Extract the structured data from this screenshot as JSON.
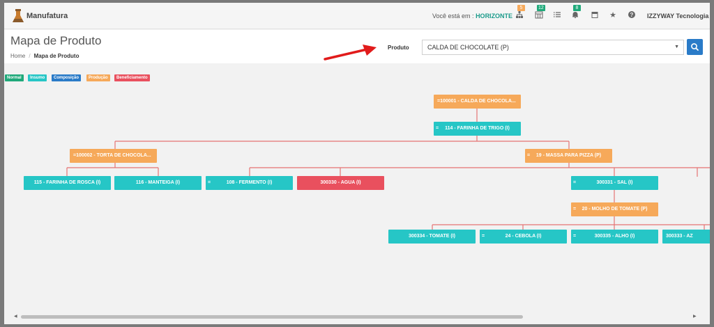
{
  "app": {
    "brand": "Manufatura",
    "location_prefix": "Você está em :",
    "location_value": "HORIZONTE",
    "user": "IZZYWAY Tecnologia"
  },
  "nav_badges": {
    "tree": "5",
    "calendar": "12",
    "bell": "8"
  },
  "colors": {
    "insumo": "#26c6c6",
    "producao": "#f6a95a",
    "beneficiamento": "#e9505e",
    "normal": "#1fa97a",
    "composicao": "#2a7bc8",
    "line": "#e57373"
  },
  "page": {
    "title": "Mapa de Produto",
    "breadcrumb_home": "Home",
    "breadcrumb_sep": "/",
    "breadcrumb_current": "Mapa de Produto"
  },
  "product": {
    "label": "Produto",
    "value": "CALDA DE CHOCOLATE (P)"
  },
  "legend": {
    "normal": "Normal",
    "insumo": "Insumo",
    "composicao": "Composição",
    "producao": "Produção",
    "beneficiamento": "Beneficiamento"
  },
  "nodes": {
    "root": {
      "pre": "=",
      "label": "100001 - CALDA DE CHOCOLA..."
    },
    "n114": {
      "pre": "=",
      "label": "114 - FARINHA DE TRIGO (I)"
    },
    "n100002": {
      "pre": "=",
      "label": "100002 - TORTA DE CHOCOLA..."
    },
    "n19": {
      "pre": "=",
      "label": "19 - MASSA PARA PIZZA (P)"
    },
    "n115": {
      "pre": "",
      "label": "115 - FARINHA DE ROSCA (I)"
    },
    "n116": {
      "pre": "",
      "label": "116 - MANTEIGA (I)"
    },
    "n108": {
      "pre": "=",
      "label": "108 - FERMENTO (I)"
    },
    "n300330": {
      "pre": "",
      "label": "300330 - AGUA (I)"
    },
    "n300331": {
      "pre": "=",
      "label": "300331 - SAL (I)"
    },
    "n20": {
      "pre": "=",
      "label": "20 - MOLHO DE TOMATE (P)"
    },
    "n300334": {
      "pre": "",
      "label": "300334 - TOMATE (I)"
    },
    "n24": {
      "pre": "=",
      "label": "24 - CEBOLA (I)"
    },
    "n300335": {
      "pre": "=",
      "label": "300335 - ALHO (I)"
    },
    "n300333": {
      "pre": "",
      "label": "300333 - AZ"
    }
  }
}
